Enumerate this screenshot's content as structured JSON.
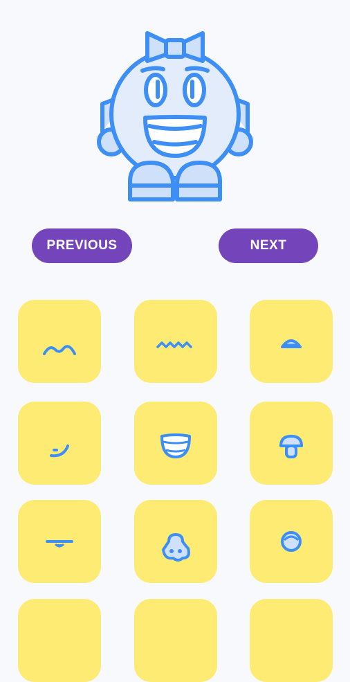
{
  "colors": {
    "background": "#f7f9fc",
    "accent_button": "#7444bb",
    "tile": "#fdeb74",
    "line": "#3d8ef5",
    "fill_light": "#cfe0fb"
  },
  "nav": {
    "previous_label": "PREVIOUS",
    "next_label": "NEXT"
  },
  "character": {
    "icon": "smiling-ball-character-with-bow-icon"
  },
  "mouth_options": [
    {
      "icon": "wavy-mouth-icon"
    },
    {
      "icon": "zigzag-mouth-icon"
    },
    {
      "icon": "small-frown-mouth-icon"
    },
    {
      "icon": "smirk-mouth-icon"
    },
    {
      "icon": "big-grin-mouth-icon"
    },
    {
      "icon": "mushroom-mouth-icon"
    },
    {
      "icon": "flat-mouth-icon"
    },
    {
      "icon": "nose-mouth-icon"
    },
    {
      "icon": "round-open-mouth-icon"
    },
    {
      "icon": "mouth-option-icon"
    },
    {
      "icon": "mouth-option-icon"
    },
    {
      "icon": "mouth-option-icon"
    }
  ]
}
